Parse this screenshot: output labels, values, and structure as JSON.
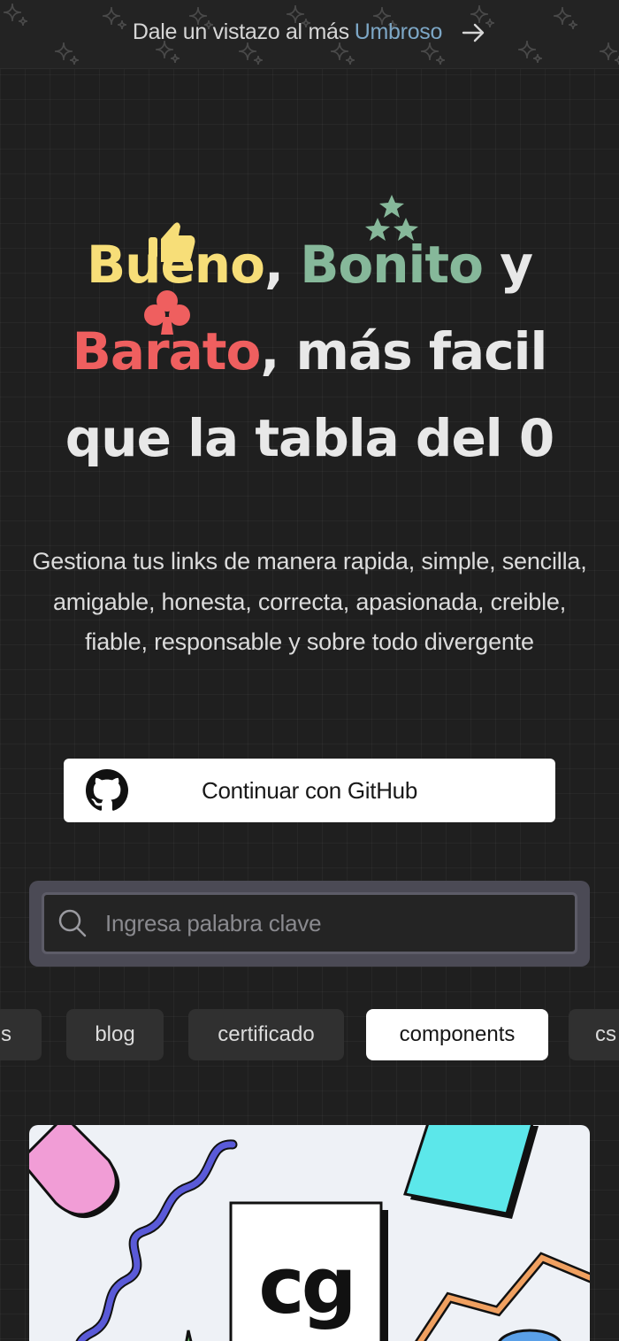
{
  "banner": {
    "text": "Dale un vistazo al más",
    "accent": "Umbroso",
    "arrow_icon": "arrow-right-icon"
  },
  "hero": {
    "word1": "Bueno",
    "sep1": ",",
    "word2": "Bonito",
    "and": "y",
    "word3": "Barato",
    "rest1": ", más facil",
    "rest2": "que la tabla del 0",
    "subtitle": "Gestiona tus links de manera rapida, simple, sencilla, amigable, honesta, correcta, apasionada, creible, fiable, responsable y sobre todo divergente"
  },
  "auth": {
    "github_label": "Continuar con GitHub",
    "icon": "github-icon"
  },
  "search": {
    "placeholder": "Ingresa palabra clave",
    "icon": "search-icon"
  },
  "tags": [
    {
      "label": "os",
      "active": false
    },
    {
      "label": "blog",
      "active": false
    },
    {
      "label": "certificado",
      "active": false
    },
    {
      "label": "components",
      "active": true
    },
    {
      "label": "cs",
      "active": false
    }
  ],
  "card": {
    "logo_text": "cg"
  },
  "colors": {
    "bueno": "#f7de78",
    "bonito": "#86b89a",
    "barato": "#ef5f5f",
    "banner_accent": "#7da7c6",
    "background": "#1f1f1f"
  }
}
